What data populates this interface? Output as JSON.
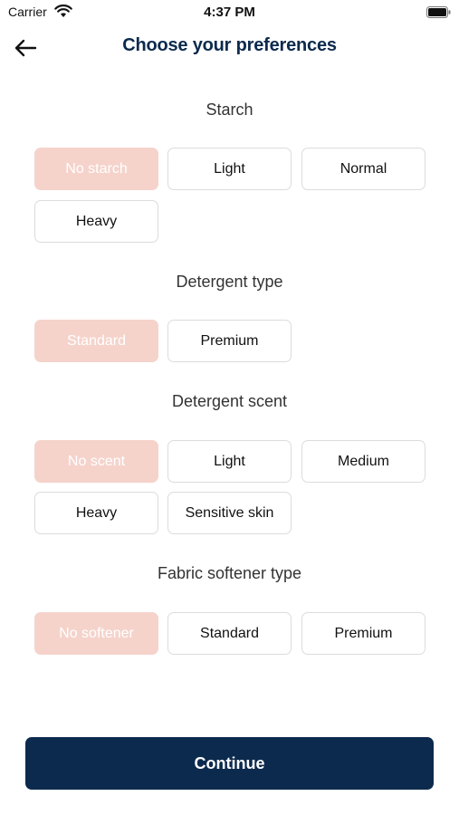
{
  "status_bar": {
    "carrier": "Carrier",
    "time": "4:37 PM"
  },
  "header": {
    "title": "Choose your preferences",
    "back_icon": "arrow-left-icon"
  },
  "sections": [
    {
      "title": "Starch",
      "options": [
        "No starch",
        "Light",
        "Normal",
        "Heavy"
      ],
      "selected": "No starch"
    },
    {
      "title": "Detergent type",
      "options": [
        "Standard",
        "Premium"
      ],
      "selected": "Standard"
    },
    {
      "title": "Detergent scent",
      "options": [
        "No scent",
        "Light",
        "Medium",
        "Heavy",
        "Sensitive skin"
      ],
      "selected": "No scent"
    },
    {
      "title": "Fabric softener type",
      "options": [
        "No softener",
        "Standard",
        "Premium"
      ],
      "selected": "No softener"
    }
  ],
  "continue_label": "Continue",
  "colors": {
    "primary": "#0c2a4d",
    "selected_bg": "#f5d3cb",
    "option_border": "#dcdcdc"
  }
}
